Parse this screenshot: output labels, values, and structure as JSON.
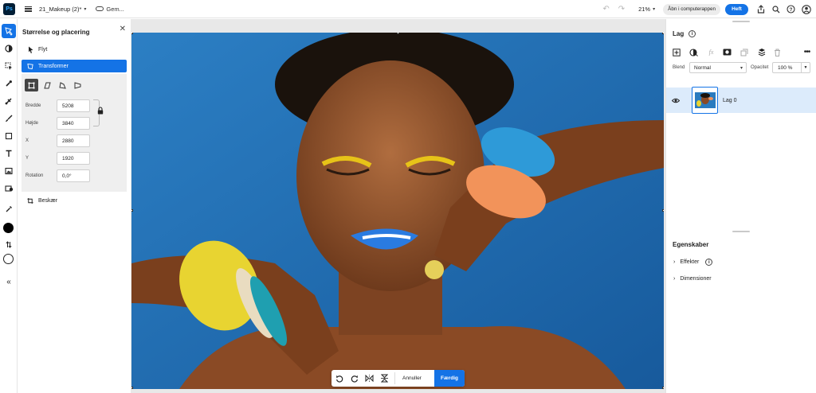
{
  "app": {
    "logo": "Ps"
  },
  "document": {
    "title": "21_Makeup (2)*",
    "save_label": "Gem..."
  },
  "topbar": {
    "zoom": "21%",
    "open_app_label": "Åbn i computerappen",
    "share_label": "Heft"
  },
  "left_panel": {
    "title": "Størrelse og placering",
    "items": {
      "move": "Flyt",
      "transform": "Transformer",
      "crop": "Beskær"
    },
    "fields": {
      "width_label": "Bredde",
      "width_value": "5208",
      "height_label": "Højde",
      "height_value": "3840",
      "x_label": "X",
      "x_value": "2880",
      "y_label": "Y",
      "y_value": "1920",
      "rotation_label": "Rotation",
      "rotation_value": "0,0°"
    }
  },
  "canvas": {
    "cancel_label": "Annuller",
    "done_label": "Færdig"
  },
  "layers_panel": {
    "title": "Lag",
    "blend_label": "Blend",
    "blend_value": "Normal",
    "opacity_label": "Opacitet",
    "opacity_value": "100 %",
    "layer_name": "Lag 0"
  },
  "properties_panel": {
    "title": "Egenskaber",
    "effects": "Effekter",
    "dimensions": "Dimensioner"
  },
  "colors": {
    "accent": "#1473e6",
    "foreground": "#000000",
    "background": "#ffffff"
  }
}
